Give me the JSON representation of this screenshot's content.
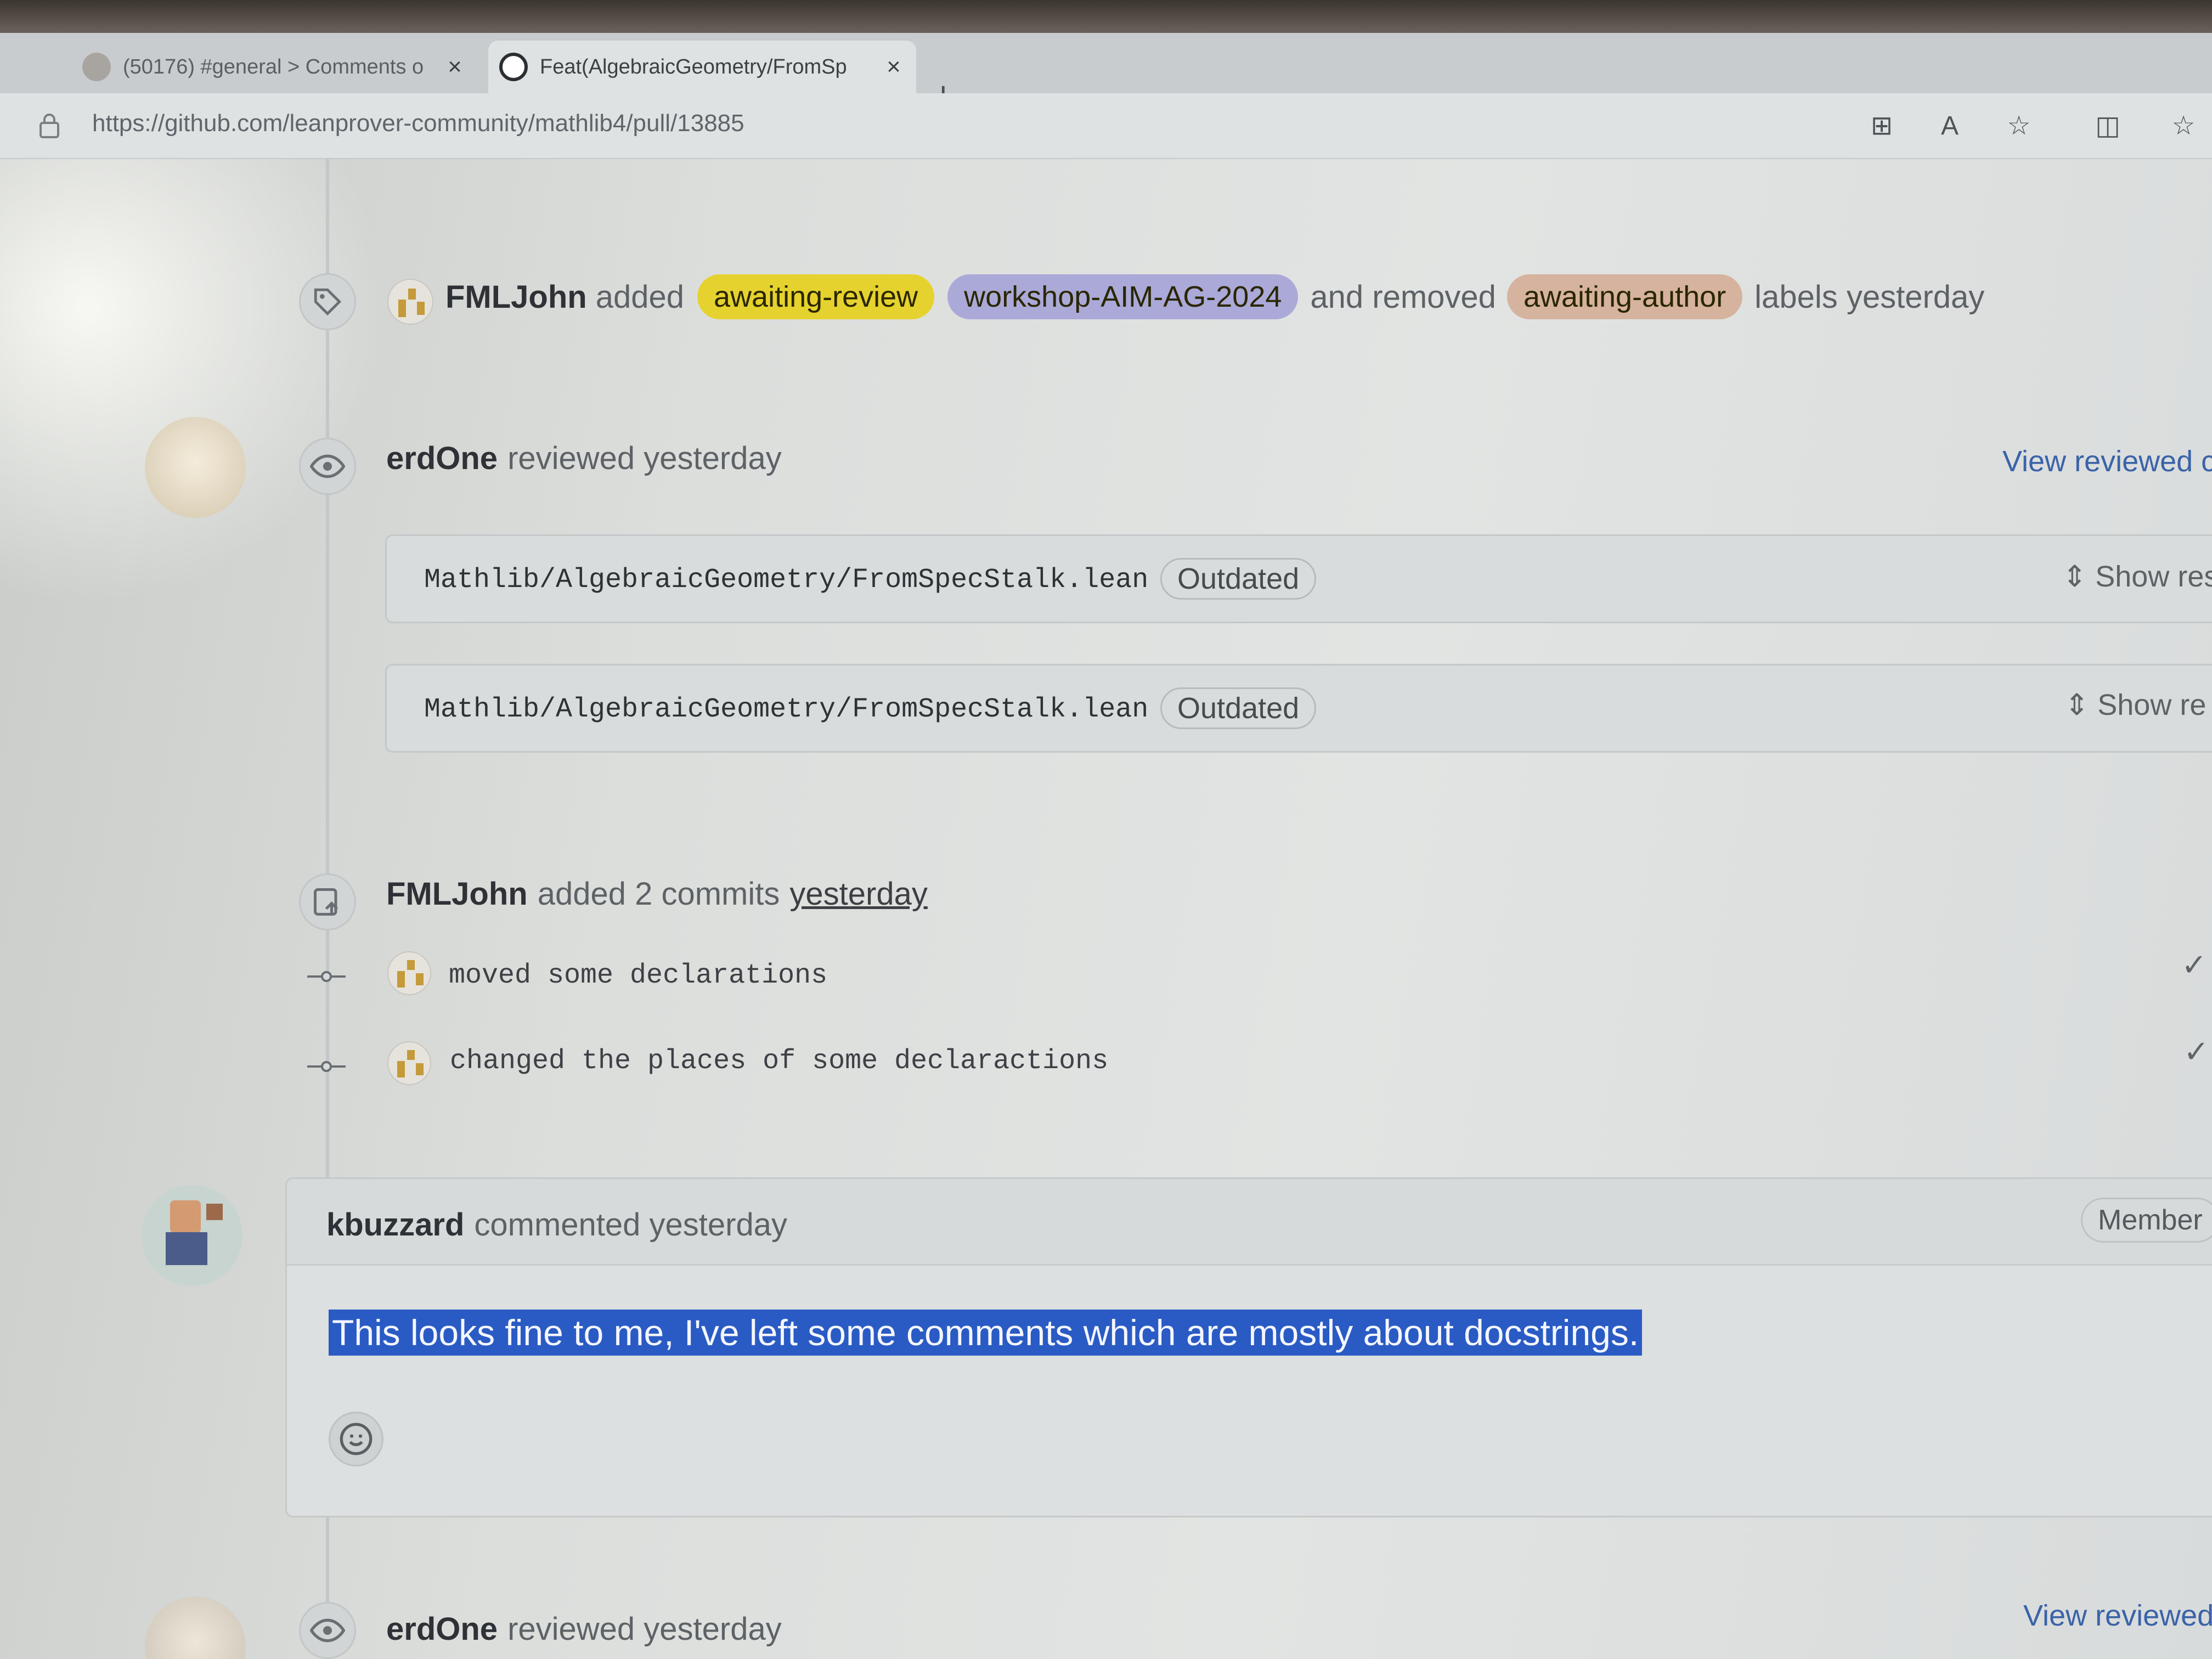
{
  "browser": {
    "tabs": [
      {
        "title": "(50176) #general > Comments o",
        "active": false
      },
      {
        "title": "Feat(AlgebraicGeometry/FromSp",
        "active": true
      }
    ],
    "new_tab_label": "+",
    "close_label": "×",
    "url": "https://github.com/leanprover-community/mathlib4/pull/13885"
  },
  "timeline": {
    "labels_event": {
      "author": "FMLJohn",
      "added_text": "added",
      "added_labels": [
        {
          "name": "awaiting-review",
          "color": "#e6d22e"
        },
        {
          "name": "workshop-AIM-AG-2024",
          "color": "#aaa9d8"
        }
      ],
      "removed_text": "and removed",
      "removed_labels": [
        {
          "name": "awaiting-author",
          "color": "#d6b39e"
        }
      ],
      "suffix": "labels yesterday"
    },
    "review1": {
      "author": "erdOne",
      "text": "reviewed yesterday",
      "view_link": "View reviewed c",
      "files": [
        {
          "path": "Mathlib/AlgebraicGeometry/FromSpecStalk.lean",
          "badge": "Outdated",
          "action": "Show res"
        },
        {
          "path": "Mathlib/AlgebraicGeometry/FromSpecStalk.lean",
          "badge": "Outdated",
          "action": "Show re"
        }
      ]
    },
    "commits_event": {
      "author": "FMLJohn",
      "text": "added 2 commits",
      "time": "yesterday",
      "commits": [
        {
          "message": "moved some declarations",
          "check": "✓"
        },
        {
          "message": "changed the places of some declaractions",
          "check": "✓"
        }
      ]
    },
    "comment": {
      "author": "kbuzzard",
      "text": "commented yesterday",
      "role": "Member",
      "body": "This looks fine to me, I've left some comments which are mostly about docstrings."
    },
    "review2": {
      "author": "erdOne",
      "text": "reviewed yesterday",
      "view_link": "View reviewed"
    }
  }
}
